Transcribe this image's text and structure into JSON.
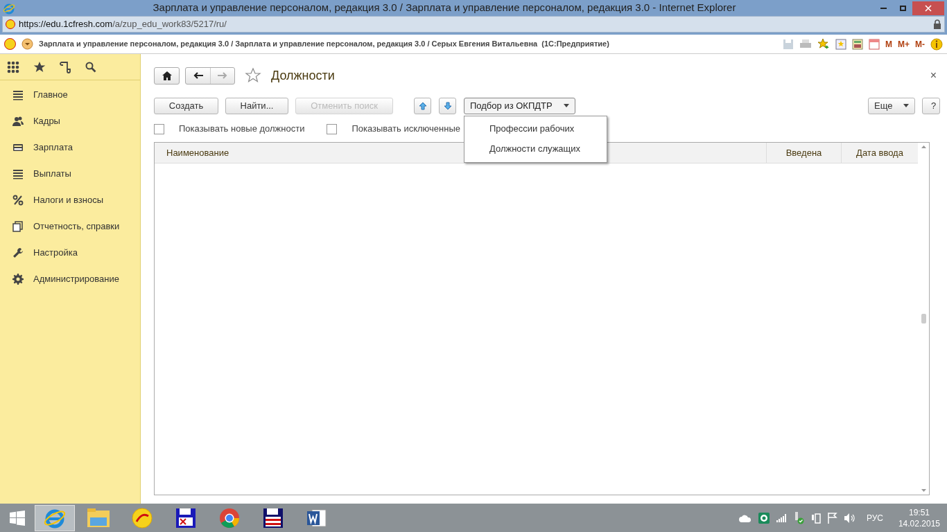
{
  "window": {
    "title": "Зарплата и управление персоналом, редакция 3.0 / Зарплата и управление персоналом, редакция 3.0 - Internet Explorer"
  },
  "address": {
    "host": "https://edu.1cfresh.com",
    "path": "/a/zup_edu_work83/5217/ru/"
  },
  "app_bar": {
    "title": "Зарплата и управление персоналом, редакция 3.0 / Зарплата и управление персоналом, редакция 3.0 / Серых Евгения Витальевна  (1С:Предприятие)",
    "memory_buttons": [
      "M",
      "M+",
      "M-"
    ]
  },
  "sidebar": {
    "items": [
      {
        "label": "Главное"
      },
      {
        "label": "Кадры"
      },
      {
        "label": "Зарплата"
      },
      {
        "label": "Выплаты"
      },
      {
        "label": "Налоги и взносы"
      },
      {
        "label": "Отчетность, справки"
      },
      {
        "label": "Настройка"
      },
      {
        "label": "Администрирование"
      }
    ]
  },
  "page": {
    "title": "Должности",
    "favorite": false,
    "close_button": "×",
    "buttons": [
      {
        "label": "Создать",
        "disabled": false
      },
      {
        "label": "Найти...",
        "disabled": false
      },
      {
        "label": "Отменить поиск",
        "disabled": true
      }
    ],
    "pick_button": {
      "label": "Подбор из ОКПДТР",
      "expanded": true,
      "menu": [
        "Профессии рабочих",
        "Должности служащих"
      ]
    },
    "more_button": "Еще",
    "help_button": "?",
    "checkboxes": [
      {
        "label": "Показывать новые должности",
        "checked": false
      },
      {
        "label": "Показывать исключенные",
        "checked": false
      }
    ],
    "table": {
      "columns": [
        "Наименование",
        "Введена",
        "Дата ввода"
      ]
    }
  },
  "taskbar": {
    "apps": [
      {
        "selected": true
      },
      {
        "selected": false
      },
      {
        "selected": false
      },
      {
        "selected": false
      },
      {
        "selected": false
      },
      {
        "selected": false
      },
      {
        "selected": false
      }
    ],
    "language": "РУС",
    "time": "19:51",
    "date": "14.02.2015"
  }
}
